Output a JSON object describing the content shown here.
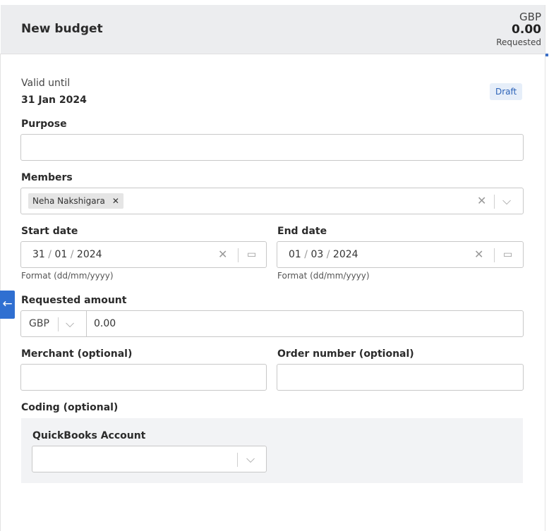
{
  "header": {
    "title": "New budget",
    "currency": "GBP",
    "amount": "0.00",
    "amount_caption": "Requested"
  },
  "status_badge": "Draft",
  "valid_until": {
    "label": "Valid until",
    "value": "31 Jan 2024"
  },
  "purpose": {
    "label": "Purpose",
    "value": ""
  },
  "members": {
    "label": "Members",
    "chips": [
      "Neha Nakshigara"
    ]
  },
  "start_date": {
    "label": "Start date",
    "day": "31",
    "month": "01",
    "year": "2024",
    "hint": "Format (dd/mm/yyyy)"
  },
  "end_date": {
    "label": "End date",
    "day": "01",
    "month": "03",
    "year": "2024",
    "hint": "Format (dd/mm/yyyy)"
  },
  "requested_amount": {
    "label": "Requested amount",
    "currency": "GBP",
    "value": "0.00"
  },
  "merchant": {
    "label": "Merchant (optional)",
    "value": ""
  },
  "order_number": {
    "label": "Order number (optional)",
    "value": ""
  },
  "coding": {
    "label": "Coding (optional)",
    "account_label": "QuickBooks Account",
    "account_value": ""
  },
  "icons": {
    "collapse": "arrow-left-icon",
    "clear": "close-icon",
    "dropdown": "chevron-down-icon",
    "calendar": "calendar-icon"
  },
  "colors": {
    "accent": "#2f6fd1",
    "header_bg": "#ecedef",
    "badge_bg": "#e6eef9",
    "badge_text": "#2c63b8"
  }
}
